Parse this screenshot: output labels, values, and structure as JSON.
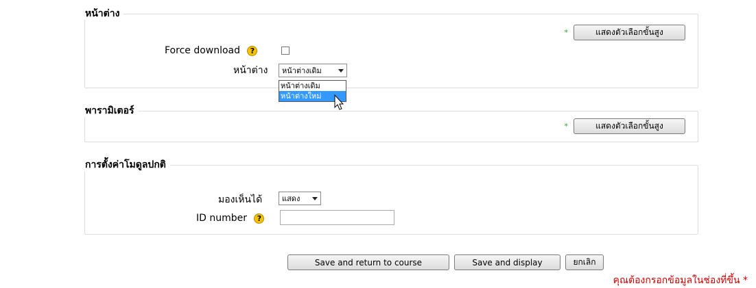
{
  "sections": {
    "window": {
      "legend": "หน้าต่าง",
      "advanced_button": "แสดงตัวเลือกขั้นสูง",
      "force_download_label": "Force download",
      "window_label": "หน้าต่าง",
      "window_select_value": "หน้าต่างเดิม",
      "window_options": [
        "หน้าต่างเดิม",
        "หน้าต่างใหม่"
      ]
    },
    "parameters": {
      "legend": "พารามิเตอร์",
      "advanced_button": "แสดงตัวเลือกขั้นสูง"
    },
    "common_module_settings": {
      "legend": "การตั้งค่าโมดูลปกติ",
      "visible_label": "มองเห็นได้",
      "visible_select_value": "แสดง",
      "id_number_label": "ID number",
      "id_number_value": ""
    }
  },
  "icons": {
    "help": "help-question-icon",
    "required_star": "*",
    "advanced_star": "*"
  },
  "actions": {
    "save_return": "Save and return to course",
    "save_display": "Save and display",
    "cancel": "ยกเลิก"
  },
  "required_note": "คุณต้องกรอกข้อมูลในช่องที่ขึ้น *",
  "colors": {
    "selected_option_bg": "#3399ff",
    "required_text": "#cc0000",
    "advanced_star": "#2aa52a"
  }
}
